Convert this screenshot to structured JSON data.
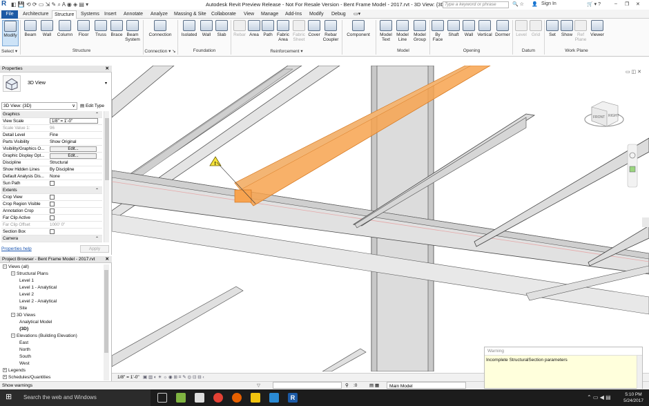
{
  "window": {
    "title": "Autodesk Revit Preview Release - Not For Resale Version -   Bent Frame Model - 2017.rvt - 3D View: {3D}",
    "search_placeholder": "Type a keyword or phrase",
    "sign_in": "Sign In"
  },
  "tabs": [
    "File",
    "Architecture",
    "Structure",
    "Systems",
    "Insert",
    "Annotate",
    "Analyze",
    "Massing & Site",
    "Collaborate",
    "View",
    "Manage",
    "Add-Ins",
    "Modify",
    "Debug"
  ],
  "ribbon": {
    "buttons": [
      {
        "label": "Modify"
      },
      {
        "label": "Beam"
      },
      {
        "label": "Wall"
      },
      {
        "label": "Column"
      },
      {
        "label": "Floor"
      },
      {
        "label": "Truss"
      },
      {
        "label": "Brace"
      },
      {
        "label": "Beam\nSystem"
      },
      {
        "label": "Connection"
      },
      {
        "label": "Isolated"
      },
      {
        "label": "Wall"
      },
      {
        "label": "Slab"
      },
      {
        "label": "Rebar"
      },
      {
        "label": "Area"
      },
      {
        "label": "Path"
      },
      {
        "label": "Fabric\nArea"
      },
      {
        "label": "Fabric\nSheet"
      },
      {
        "label": "Cover"
      },
      {
        "label": "Rebar\nCoupler"
      },
      {
        "label": "Component"
      },
      {
        "label": "Model\nText"
      },
      {
        "label": "Model\nLine"
      },
      {
        "label": "Model\nGroup"
      },
      {
        "label": "By\nFace"
      },
      {
        "label": "Shaft"
      },
      {
        "label": "Wall"
      },
      {
        "label": "Vertical"
      },
      {
        "label": "Dormer"
      },
      {
        "label": "Level"
      },
      {
        "label": "Grid"
      },
      {
        "label": "Set"
      },
      {
        "label": "Show"
      },
      {
        "label": "Ref\nPlane"
      },
      {
        "label": "Viewer"
      }
    ],
    "groups": [
      "Select ▾",
      "Structure",
      "Connection ▾ ↘",
      "Foundation",
      "Reinforcement ▾",
      "Model",
      "Opening",
      "Datum",
      "Work Plane"
    ]
  },
  "properties": {
    "header": "Properties",
    "type_name": "3D View",
    "view_selector": "3D View: {3D}",
    "edit_type": "Edit Type",
    "rows": [
      {
        "k": "Graphics",
        "v": "",
        "section": true
      },
      {
        "k": "View Scale",
        "v": "1/8\" = 1'-0\"",
        "box": true
      },
      {
        "k": "Scale Value    1:",
        "v": "96",
        "dim": true
      },
      {
        "k": "Detail Level",
        "v": "Fine"
      },
      {
        "k": "Parts Visibility",
        "v": "Show Original"
      },
      {
        "k": "Visibility/Graphics O...",
        "v": "Edit...",
        "btn": true
      },
      {
        "k": "Graphic Display Opt...",
        "v": "Edit...",
        "btn": true
      },
      {
        "k": "Discipline",
        "v": "Structural"
      },
      {
        "k": "Show Hidden Lines",
        "v": "By Discipline"
      },
      {
        "k": "Default Analysis Dis...",
        "v": "None"
      },
      {
        "k": "Sun Path",
        "v": "",
        "chk": true
      },
      {
        "k": "Extents",
        "v": "",
        "section": true
      },
      {
        "k": "Crop View",
        "v": "",
        "chk": true
      },
      {
        "k": "Crop Region Visible",
        "v": "",
        "chk": true
      },
      {
        "k": "Annotation Crop",
        "v": "",
        "chk": true
      },
      {
        "k": "Far Clip Active",
        "v": "",
        "chk": true
      },
      {
        "k": "Far Clip Offset",
        "v": "1000'  0\"",
        "dim": true
      },
      {
        "k": "Section Box",
        "v": "",
        "chk": true
      },
      {
        "k": "Camera",
        "v": "",
        "section": true
      }
    ],
    "help_link": "Properties help",
    "apply": "Apply"
  },
  "browser": {
    "header": "Project Browser - Bent Frame Model - 2017.rvt",
    "items": [
      {
        "t": "Views (all)",
        "lvl": 0,
        "tg": "−"
      },
      {
        "t": "Structural Plans",
        "lvl": 1,
        "tg": "−"
      },
      {
        "t": "Level 1",
        "lvl": 2
      },
      {
        "t": "Level 1 - Analytical",
        "lvl": 2
      },
      {
        "t": "Level 2",
        "lvl": 2
      },
      {
        "t": "Level 2 - Analytical",
        "lvl": 2
      },
      {
        "t": "Site",
        "lvl": 2
      },
      {
        "t": "3D Views",
        "lvl": 1,
        "tg": "−"
      },
      {
        "t": "Analytical Model",
        "lvl": 2
      },
      {
        "t": "{3D}",
        "lvl": 2,
        "bold": true
      },
      {
        "t": "Elevations (Building Elevation)",
        "lvl": 1,
        "tg": "−"
      },
      {
        "t": "East",
        "lvl": 2
      },
      {
        "t": "North",
        "lvl": 2
      },
      {
        "t": "South",
        "lvl": 2
      },
      {
        "t": "West",
        "lvl": 2
      },
      {
        "t": "Legends",
        "lvl": 0,
        "tg": "+"
      },
      {
        "t": "Schedules/Quantities",
        "lvl": 0,
        "tg": "+"
      }
    ]
  },
  "viewbar": {
    "scale": "1/8\" = 1'-0\"",
    "model": "Main Model",
    "zero": ":0"
  },
  "status": {
    "text": "Show warnings"
  },
  "warning": {
    "title": "Warning",
    "message": "Incomplete StructuralSection parameters"
  },
  "viewcube": {
    "front": "FRONT",
    "right": "RIGHT"
  },
  "taskbar": {
    "search": "Search the web and Windows",
    "time": "5:10 PM",
    "date": "5/24/2017"
  },
  "colors": {
    "file_tab": "#1c5aa5",
    "selection": "#f7a34f",
    "beam": "#d8d8d8",
    "taskbar": "#1c1c1c"
  }
}
